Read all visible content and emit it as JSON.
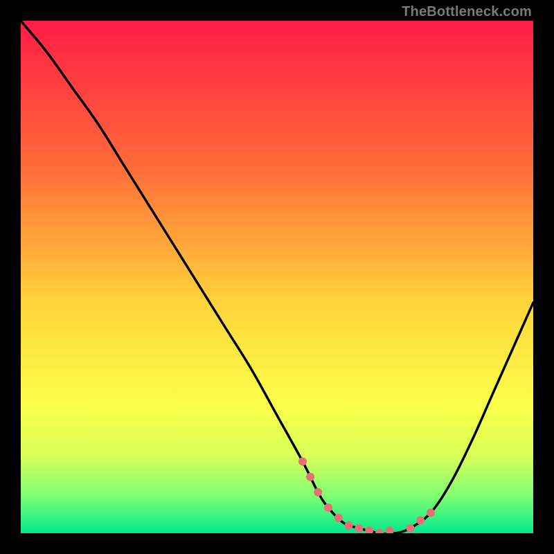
{
  "attribution": "TheBottleneck.com",
  "chart_data": {
    "type": "line",
    "title": "",
    "xlabel": "",
    "ylabel": "",
    "xlim": [
      0,
      100
    ],
    "ylim": [
      0,
      100
    ],
    "gradient_stops": [
      {
        "offset": 0,
        "color": "#ff1c47"
      },
      {
        "offset": 28,
        "color": "#ff6a3a"
      },
      {
        "offset": 55,
        "color": "#ffd43a"
      },
      {
        "offset": 75,
        "color": "#faff4a"
      },
      {
        "offset": 85,
        "color": "#d8ff57"
      },
      {
        "offset": 93,
        "color": "#7bff74"
      },
      {
        "offset": 100,
        "color": "#00e98c"
      }
    ],
    "series": [
      {
        "name": "bottleneck-curve",
        "x": [
          0,
          5,
          10,
          15,
          20,
          25,
          30,
          35,
          40,
          45,
          50,
          55,
          58,
          60,
          63,
          66,
          70,
          73,
          76,
          80,
          84,
          88,
          92,
          96,
          100
        ],
        "y": [
          100,
          94,
          87,
          80,
          72,
          64,
          56,
          48,
          40,
          32,
          23,
          14,
          8,
          5,
          2,
          1,
          0,
          0,
          1,
          4,
          10,
          18,
          27,
          36,
          45
        ]
      }
    ],
    "markers": {
      "name": "highlight-points",
      "color": "#e96f74",
      "radius": 6,
      "x": [
        55,
        56.5,
        58,
        60,
        62,
        64,
        66,
        68,
        70,
        72,
        76,
        78,
        80
      ],
      "y": [
        14,
        11,
        8,
        5,
        3,
        1.5,
        1,
        0.5,
        0,
        0.5,
        1,
        2.5,
        4
      ]
    }
  }
}
